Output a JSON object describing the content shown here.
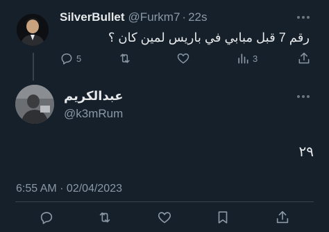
{
  "tweet": {
    "display_name": "SilverBullet",
    "handle": "@Furkm7",
    "separator": "·",
    "time": "22s",
    "text": "رقم 7 قبل مبابي في باريس لمين كان ؟",
    "replies": "5",
    "views": "3",
    "icons": {
      "reply": "reply-icon",
      "retweet": "retweet-icon",
      "like": "like-icon",
      "views": "views-icon",
      "share": "share-icon",
      "more": "more-icon"
    }
  },
  "reply": {
    "display_name": "عبدالكريم",
    "handle": "@k3mRum",
    "text": "٢٩",
    "timestamp": "6:55 AM · 02/04/2023",
    "icons": {
      "reply": "reply-icon",
      "retweet": "retweet-icon",
      "like": "like-icon",
      "bookmark": "bookmark-icon",
      "share": "share-icon",
      "more": "more-icon"
    }
  },
  "colors": {
    "background": "#15202b",
    "primary_text": "#e7e9ea",
    "secondary_text": "#8b98a5",
    "divider": "#38444d"
  }
}
